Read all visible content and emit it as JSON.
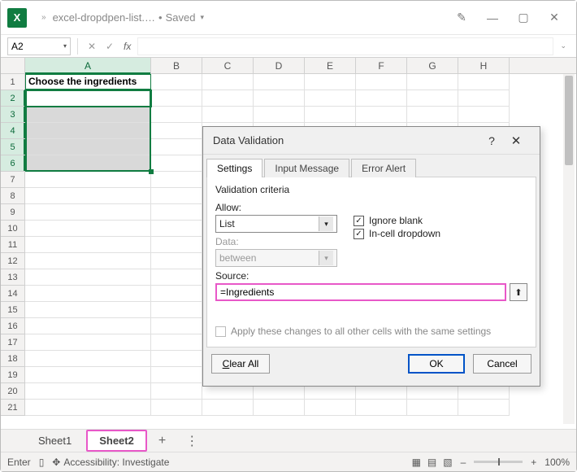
{
  "titlebar": {
    "filename": "excel-dropdpen-list.…",
    "saved": "Saved",
    "chevron": "»"
  },
  "formulabar": {
    "namebox": "A2",
    "fx": "fx",
    "value": ""
  },
  "grid": {
    "columns": [
      "A",
      "B",
      "C",
      "D",
      "E",
      "F",
      "G",
      "H"
    ],
    "rows": 21,
    "a1": "Choose the ingredients"
  },
  "sheets": {
    "items": [
      "Sheet1",
      "Sheet2"
    ],
    "active": 1,
    "plus": "+",
    "more": "⋮"
  },
  "statusbar": {
    "mode": "Enter",
    "accessibility": "Accessibility: Investigate",
    "zoom": "100%",
    "plus": "+",
    "minus": "–"
  },
  "dialog": {
    "title": "Data Validation",
    "help": "?",
    "close": "✕",
    "tabs": [
      "Settings",
      "Input Message",
      "Error Alert"
    ],
    "criteria_label": "Validation criteria",
    "allow_label": "Allow:",
    "allow_value": "List",
    "data_label": "Data:",
    "data_value": "between",
    "ignore_blank": "Ignore blank",
    "incell_dropdown": "In-cell dropdown",
    "source_label": "Source:",
    "source_value": "=Ingredients",
    "apply_all": "Apply these changes to all other cells with the same settings",
    "clear_all": "Clear All",
    "ok": "OK",
    "cancel": "Cancel",
    "checkmark": "✓",
    "picker_icon": "⬆"
  }
}
